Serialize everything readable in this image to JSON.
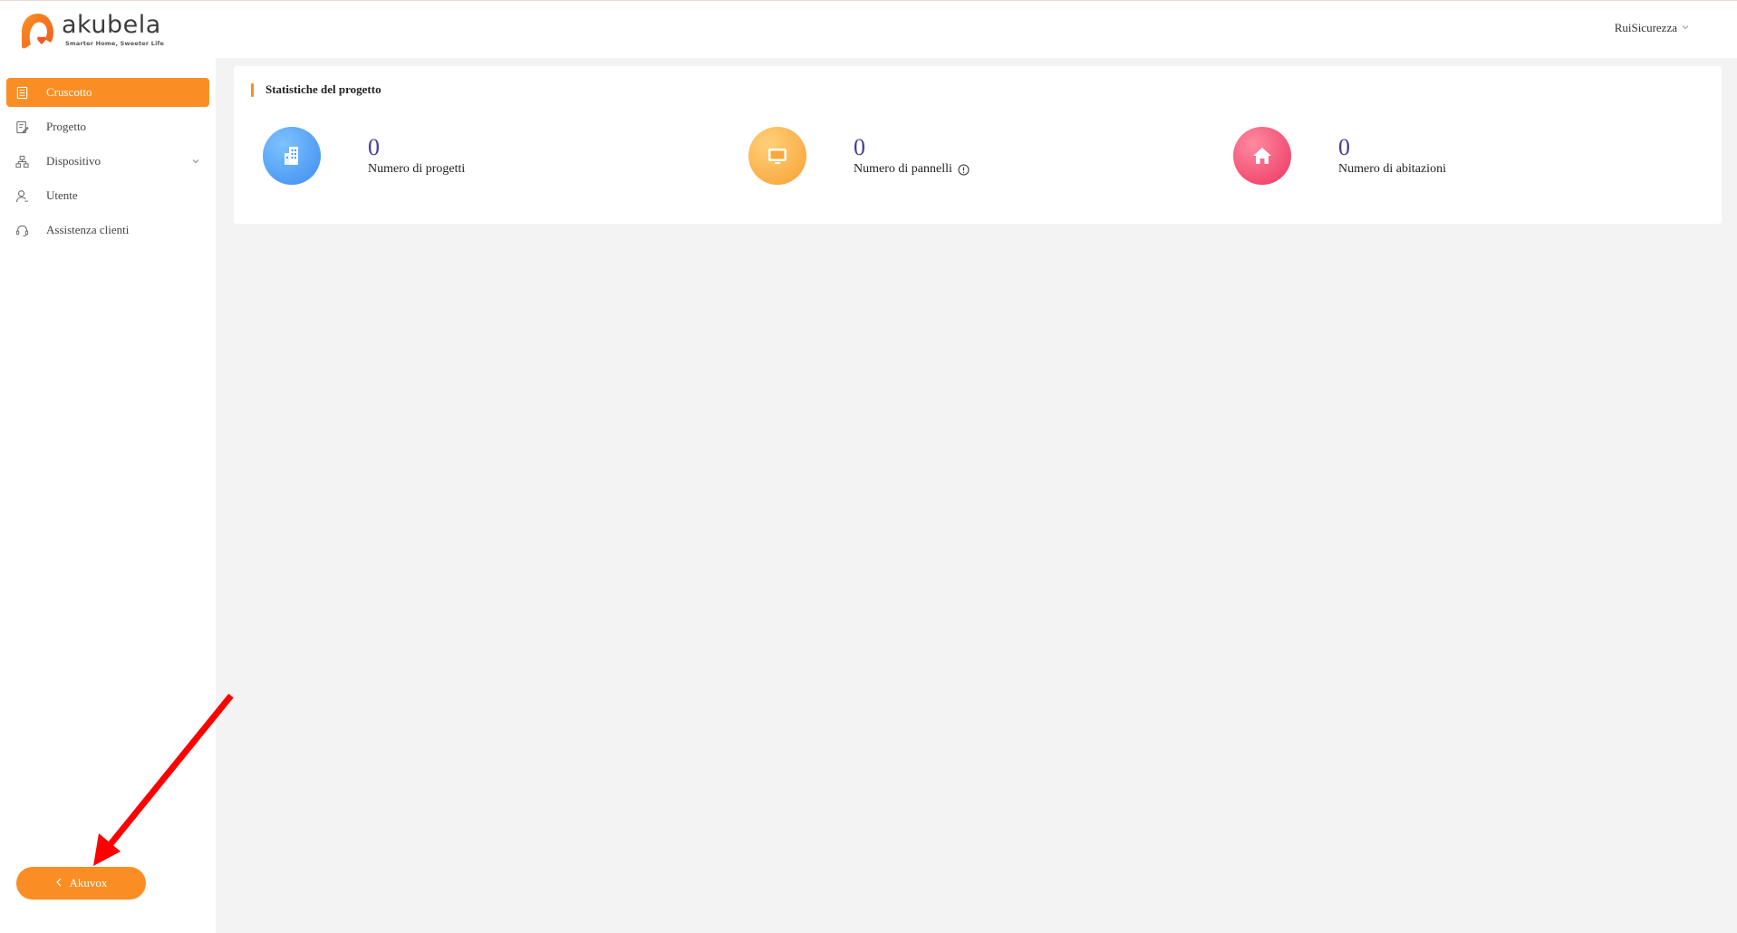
{
  "header": {
    "logo_word": "akubela",
    "logo_tagline": "Smarter Home, Sweeter Life",
    "user_name": "RuiSicurezza"
  },
  "sidebar": {
    "items": [
      {
        "label": "Cruscotto",
        "icon": "dashboard-icon",
        "active": true
      },
      {
        "label": "Progetto",
        "icon": "document-edit-icon",
        "active": false
      },
      {
        "label": "Dispositivo",
        "icon": "network-devices-icon",
        "active": false,
        "expandable": true
      },
      {
        "label": "Utente",
        "icon": "user-icon",
        "active": false
      },
      {
        "label": "Assistenza clienti",
        "icon": "support-headset-icon",
        "active": false
      }
    ],
    "back_button_label": "Akuvox"
  },
  "main": {
    "card_title": "Statistiche del progetto",
    "stats": [
      {
        "value": "0",
        "label": "Numero di progetti",
        "icon": "building-icon",
        "color": "#4a9af5"
      },
      {
        "value": "0",
        "label": "Numero di pannelli",
        "icon": "monitor-icon",
        "color": "#f9a93a",
        "has_info": true
      },
      {
        "value": "0",
        "label": "Numero di abitazioni",
        "icon": "home-icon",
        "color": "#f0436b"
      }
    ]
  },
  "colors": {
    "accent": "#fa8e24",
    "value_text": "#4a3c98",
    "background": "#f3f3f3",
    "annotation_arrow": "#ff0000"
  }
}
